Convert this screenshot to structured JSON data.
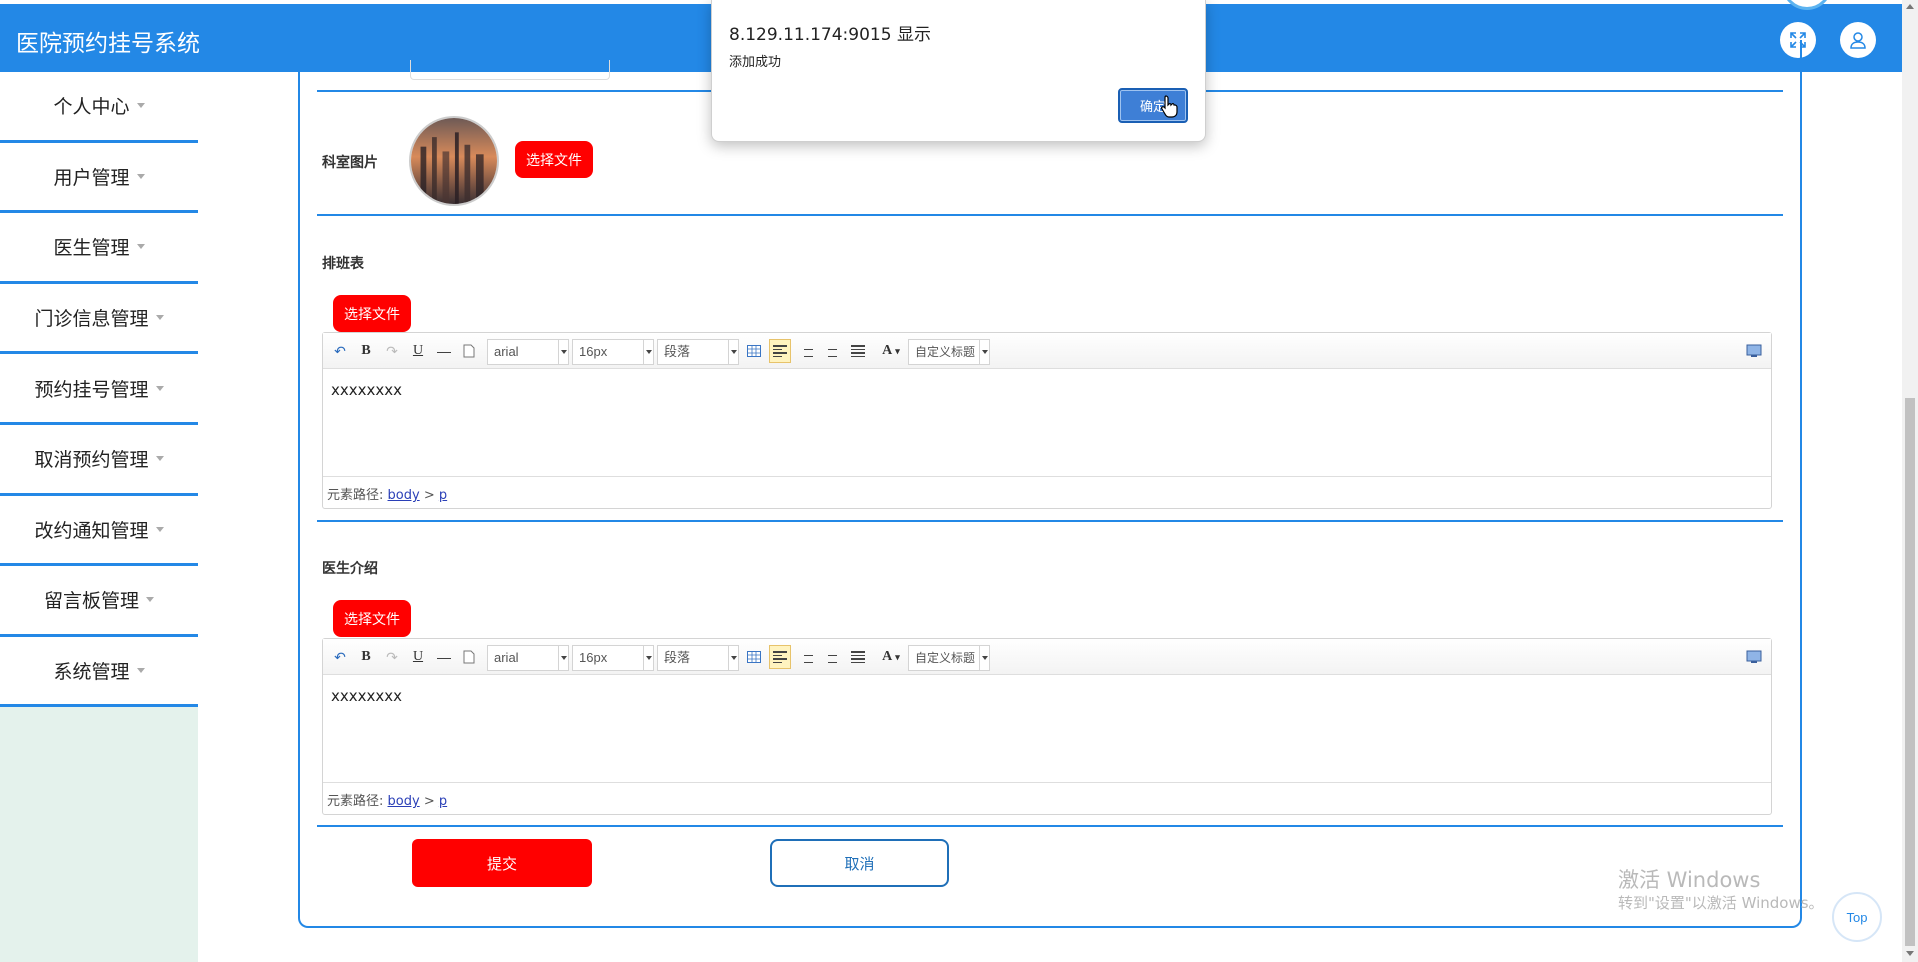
{
  "app": {
    "title": "医院预约挂号系统"
  },
  "header": {
    "icons": [
      "fullscreen-icon",
      "user-icon"
    ]
  },
  "sidebar": {
    "items": [
      {
        "label": "个人中心"
      },
      {
        "label": "用户管理"
      },
      {
        "label": "医生管理"
      },
      {
        "label": "门诊信息管理"
      },
      {
        "label": "预约挂号管理"
      },
      {
        "label": "取消预约管理"
      },
      {
        "label": "改约通知管理"
      },
      {
        "label": "留言板管理"
      },
      {
        "label": "系统管理"
      }
    ]
  },
  "form": {
    "dept_image_label": "科室图片",
    "choose_file": "选择文件",
    "schedule_label": "排班表",
    "intro_label": "医生介绍",
    "submit": "提交",
    "cancel": "取消"
  },
  "editor": {
    "font_family": "arial",
    "font_size": "16px",
    "paragraph": "段落",
    "custom_title": "自定义标题",
    "font_color_glyph": "A",
    "bold_glyph": "B",
    "underline_glyph": "U",
    "path_prefix": "元素路径:",
    "path_body": "body",
    "path_sep": ">",
    "path_p": "p",
    "schedule_content": "xxxxxxxx",
    "intro_content": "xxxxxxxx"
  },
  "dialog": {
    "host": "8.129.11.174:9015 显示",
    "message": "添加成功",
    "ok": "确定"
  },
  "watermark": {
    "line1": "激活 Windows",
    "line2": "转到\"设置\"以激活 Windows。"
  },
  "top_button": "Top",
  "colors": {
    "primary": "#2388e6",
    "danger": "#ff0000",
    "sidebar_bg": "#e4f2ec"
  }
}
